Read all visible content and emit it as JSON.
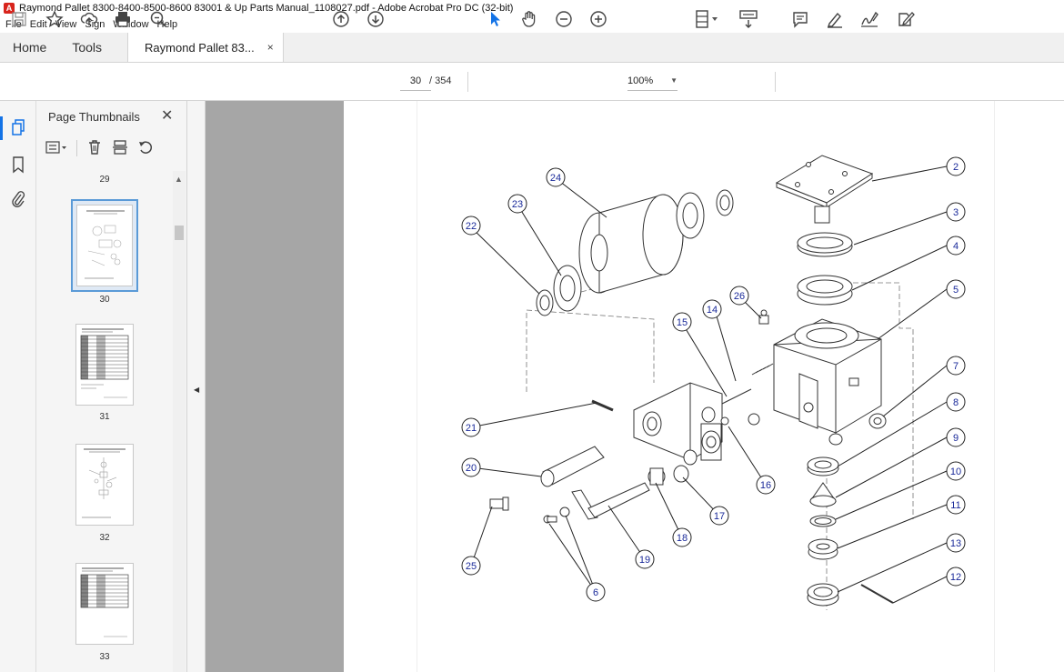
{
  "window": {
    "title": "Raymond Pallet 8300-8400-8500-8600 83001 & Up Parts Manual_1108027.pdf - Adobe Acrobat Pro DC (32-bit)"
  },
  "menu": [
    "File",
    "Edit",
    "View",
    "Sign",
    "Window",
    "Help"
  ],
  "tabs": {
    "home": "Home",
    "tools": "Tools",
    "document": "Raymond Pallet 83...",
    "close_glyph": "×"
  },
  "toolbar": {
    "current_page": "30",
    "page_total": "/ 354",
    "zoom": "100%",
    "icons": [
      "save-icon",
      "bookmark-star-icon",
      "upload-cloud-icon",
      "print-icon",
      "search-zoom-icon",
      "page-up-icon",
      "page-down-icon",
      "select-arrow-icon",
      "hand-icon",
      "zoom-out-icon",
      "zoom-in-icon",
      "fit-page-icon",
      "scroll-mode-icon",
      "comment-icon",
      "highlight-pen-icon",
      "sign-icon",
      "fill-sign-icon"
    ]
  },
  "sidebar": {
    "panel_title": "Page Thumbnails",
    "close_glyph": "✕",
    "thumbnails": [
      {
        "page": "29",
        "selected": false
      },
      {
        "page": "30",
        "selected": true
      },
      {
        "page": "31",
        "selected": false
      },
      {
        "page": "32",
        "selected": false
      },
      {
        "page": "33",
        "selected": false
      }
    ]
  },
  "diagram": {
    "callouts": [
      "2",
      "3",
      "4",
      "5",
      "7",
      "8",
      "9",
      "10",
      "11",
      "13",
      "12",
      "26",
      "14",
      "15",
      "24",
      "23",
      "22",
      "21",
      "16",
      "20",
      "17",
      "18",
      "19",
      "25",
      "6"
    ]
  },
  "colors": {
    "accent": "#1473e6",
    "callout": "#1a2a9a",
    "gutter": "#a6a6a6"
  }
}
